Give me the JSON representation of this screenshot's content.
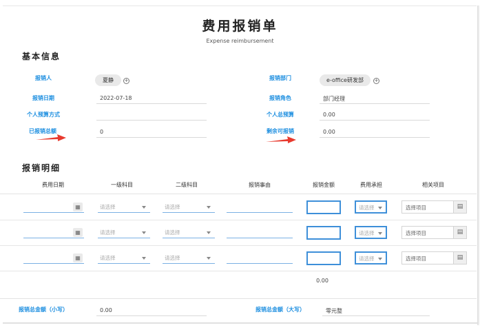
{
  "header": {
    "title": "费用报销单",
    "subtitle": "Expense reimbursement"
  },
  "basic": {
    "section_title": "基本信息",
    "applicant_label": "报销人",
    "applicant_value": "夏静",
    "department_label": "报销部门",
    "department_value": "e-office研发部",
    "date_label": "报销日期",
    "date_value": "2022-07-18",
    "role_label": "报销角色",
    "role_value": "部门经理",
    "budget_mode_label": "个人预算方式",
    "budget_mode_value": "",
    "total_budget_label": "个人总预算",
    "total_budget_value": "0.00",
    "reimbursed_total_label": "已报销总额",
    "reimbursed_total_value": "0",
    "remaining_label": "剩余可报销",
    "remaining_value": "0.00"
  },
  "details": {
    "section_title": "报销明细",
    "columns": [
      "费用日期",
      "一级科目",
      "二级科目",
      "报销事由",
      "报销金额",
      "费用承担",
      "相关项目"
    ],
    "rows": [
      {
        "date": "",
        "subject1": "请选择",
        "subject2": "请选择",
        "reason": "",
        "amount": "",
        "bearer": "请选择",
        "project": "选择项目"
      },
      {
        "date": "",
        "subject1": "请选择",
        "subject2": "请选择",
        "reason": "",
        "amount": "",
        "bearer": "请选择",
        "project": "选择项目"
      },
      {
        "date": "",
        "subject1": "请选择",
        "subject2": "请选择",
        "reason": "",
        "amount": "",
        "bearer": "请选择",
        "project": "选择项目"
      }
    ],
    "amount_total": "0.00"
  },
  "footer": {
    "total_small_label": "报销总金额（小写）",
    "total_small_value": "0.00",
    "total_big_label": "报销总金额（大写）",
    "total_big_value": "零元整"
  },
  "icons": {
    "calendar": "calendar-icon",
    "plus": "plus-circle-icon",
    "dropdown": "chevron-down-icon",
    "project_picker": "document-icon",
    "annotation_arrow": "red-arrow-annotation"
  },
  "colors": {
    "label_blue": "#1e8fe0",
    "input_border_blue": "#3d8fd9",
    "annotation_red": "#e83a2e"
  }
}
